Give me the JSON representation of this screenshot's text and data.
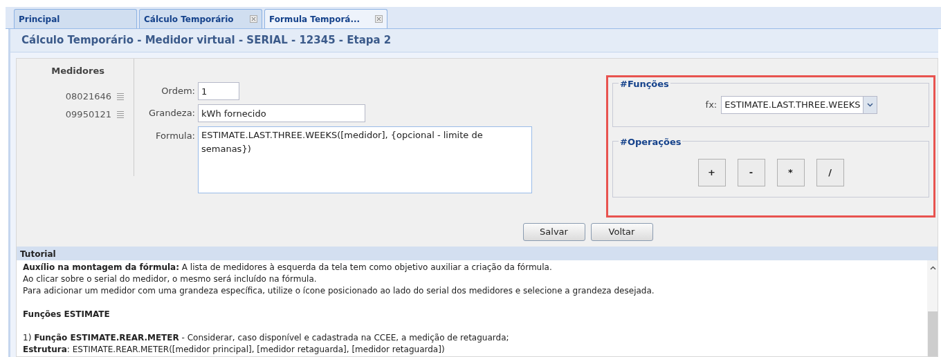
{
  "tabs": [
    {
      "label": "Principal",
      "selected": false,
      "closable": false
    },
    {
      "label": "Cálculo Temporário",
      "selected": false,
      "closable": true
    },
    {
      "label": "Formula Temporá...",
      "selected": true,
      "closable": true
    }
  ],
  "panel_title": "Cálculo Temporário - Medidor virtual - SERIAL - 12345 - Etapa 2",
  "medidores": {
    "title": "Medidores",
    "items": [
      "08021646",
      "09950121"
    ]
  },
  "form": {
    "ordem": {
      "label": "Ordem:",
      "value": "1"
    },
    "grandeza": {
      "label": "Grandeza:",
      "value": "kWh fornecido"
    },
    "formula": {
      "label": "Formula:",
      "value": "ESTIMATE.LAST.THREE.WEEKS([medidor], {opcional - limite de semanas})"
    }
  },
  "funcoes": {
    "legend": "#Funções",
    "label": "fx:",
    "value": "ESTIMATE.LAST.THREE.WEEKS"
  },
  "operacoes": {
    "legend": "#Operações",
    "buttons": [
      "+",
      "-",
      "*",
      "/"
    ]
  },
  "actions": [
    "Salvar",
    "Voltar"
  ],
  "tutorial": {
    "title": "Tutorial",
    "paragraphs": [
      {
        "kind": "text",
        "text": "**Auxílio na montagem da fórmula:** A lista de medidores à esquerda da tela tem como objetivo auxiliar a criação da fórmula."
      },
      {
        "kind": "text",
        "text": "Ao clicar sobre o serial do medidor, o mesmo será incluído na fórmula."
      },
      {
        "kind": "text",
        "text": "Para adicionar um medidor com uma grandeza específica, utilize o ícone posicionado ao lado do serial dos medidores e selecione a grandeza desejada."
      },
      {
        "kind": "heading",
        "text": "Funções ESTIMATE"
      },
      {
        "kind": "text",
        "text": "1) **Função ESTIMATE.REAR.METER** - Considerar, caso disponível e cadastrada na CCEE, a medição de retaguarda;"
      },
      {
        "kind": "text",
        "text": "**Estrutura**: ESTIMATE.REAR.METER([medidor principal], [medidor retaguarda], [medidor retaguarda])"
      }
    ]
  }
}
